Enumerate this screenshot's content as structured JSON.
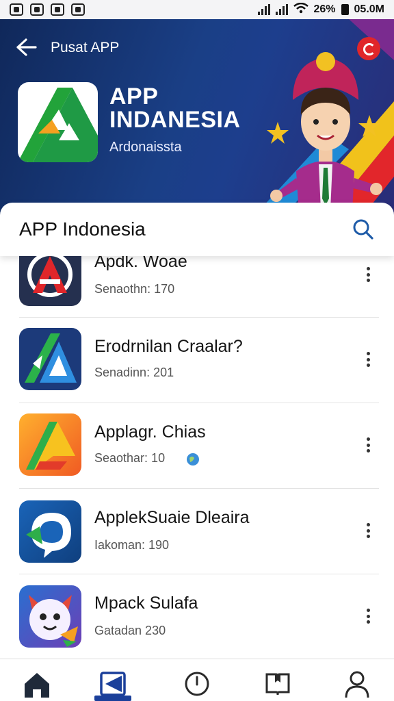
{
  "status_bar": {
    "battery": "26%",
    "time": "05.0M"
  },
  "header": {
    "title": "Pusat APP",
    "brand_line1": "APP",
    "brand_line2": "INDANESIA",
    "brand_sub": "Ardonaissta"
  },
  "search": {
    "value": "APP Indonesia"
  },
  "apps": [
    {
      "name": "Apdk. Woae",
      "meta": "Senaothn: 170",
      "icon": "red-a-logo-icon"
    },
    {
      "name": "Erodrnilan Craalar?",
      "meta": "Senadinn: 201",
      "icon": "blue-green-a-logo-icon"
    },
    {
      "name": "Applagr. Chias",
      "meta": "Seaothar: 10",
      "icon": "orange-a-logo-icon"
    },
    {
      "name": "ApplekSuaie Dleaira",
      "meta": "Iakoman: 190",
      "icon": "blue-chat-logo-icon"
    },
    {
      "name": "Mpack Sulafa",
      "meta": "Gatadan 230",
      "icon": "cartoon-character-icon"
    }
  ],
  "nav": [
    {
      "name": "home",
      "icon": "home-icon"
    },
    {
      "name": "apps",
      "icon": "apps-icon",
      "active": true
    },
    {
      "name": "updates",
      "icon": "clock-icon"
    },
    {
      "name": "library",
      "icon": "book-icon"
    },
    {
      "name": "profile",
      "icon": "person-icon"
    }
  ],
  "colors": {
    "header_dark": "#10285a",
    "accent": "#1a3f9a",
    "logo_green": "#22a33a",
    "logo_orange": "#f5a020"
  }
}
